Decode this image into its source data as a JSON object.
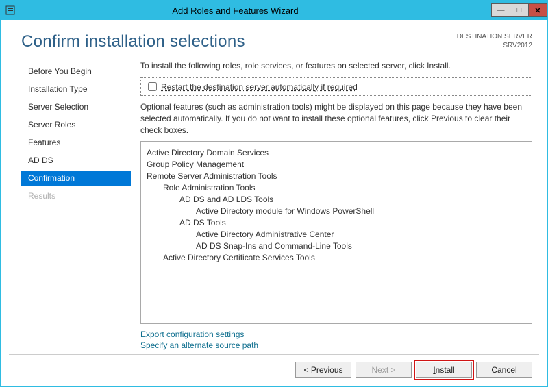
{
  "window": {
    "title": "Add Roles and Features Wizard"
  },
  "header": {
    "pageTitle": "Confirm installation selections",
    "destLabel": "DESTINATION SERVER",
    "destServer": "SRV2012"
  },
  "steps": [
    {
      "label": "Before You Begin",
      "state": "normal"
    },
    {
      "label": "Installation Type",
      "state": "normal"
    },
    {
      "label": "Server Selection",
      "state": "normal"
    },
    {
      "label": "Server Roles",
      "state": "normal"
    },
    {
      "label": "Features",
      "state": "normal"
    },
    {
      "label": "AD DS",
      "state": "normal"
    },
    {
      "label": "Confirmation",
      "state": "active"
    },
    {
      "label": "Results",
      "state": "disabled"
    }
  ],
  "main": {
    "intro": "To install the following roles, role services, or features on selected server, click Install.",
    "restartLabel": "Restart the destination server automatically if required",
    "optionalText": "Optional features (such as administration tools) might be displayed on this page because they have been selected automatically. If you do not want to install these optional features, click Previous to clear their check boxes.",
    "items": [
      {
        "level": 0,
        "text": "Active Directory Domain Services"
      },
      {
        "level": 0,
        "text": "Group Policy Management"
      },
      {
        "level": 0,
        "text": "Remote Server Administration Tools"
      },
      {
        "level": 1,
        "text": "Role Administration Tools"
      },
      {
        "level": 2,
        "text": "AD DS and AD LDS Tools"
      },
      {
        "level": 3,
        "text": "Active Directory module for Windows PowerShell"
      },
      {
        "level": 2,
        "text": "AD DS Tools"
      },
      {
        "level": 3,
        "text": "Active Directory Administrative Center"
      },
      {
        "level": 3,
        "text": "AD DS Snap-Ins and Command-Line Tools"
      },
      {
        "level": 1,
        "text": "Active Directory Certificate Services Tools"
      }
    ],
    "links": {
      "export": "Export configuration settings",
      "altPath": "Specify an alternate source path"
    }
  },
  "footer": {
    "previous": "< Previous",
    "next": "Next >",
    "install": "Install",
    "cancel": "Cancel"
  }
}
